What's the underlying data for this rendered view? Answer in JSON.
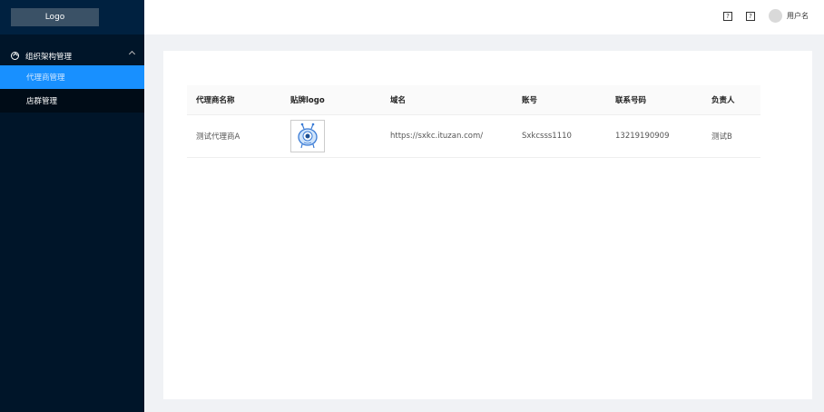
{
  "sidebar": {
    "logo": "Logo",
    "group_label": "组织架构管理",
    "items": [
      {
        "label": "代理商管理",
        "active": true
      },
      {
        "label": "店群管理",
        "active": false
      }
    ]
  },
  "header": {
    "help_icon_1": "?",
    "help_icon_2": "?",
    "username": "用户名"
  },
  "table": {
    "columns": [
      "代理商名称",
      "贴牌logo",
      "域名",
      "账号",
      "联系号码",
      "负责人"
    ],
    "rows": [
      {
        "name": "测试代理商A",
        "logo_icon": "alien-mascot-icon",
        "domain": "https://sxkc.ituzan.com/",
        "account": "Sxkcsss1110",
        "phone": "13219190909",
        "owner": "测试B"
      }
    ]
  },
  "colors": {
    "sidebar_bg": "#001529",
    "active_item": "#1890ff",
    "page_bg": "#f0f2f5"
  }
}
